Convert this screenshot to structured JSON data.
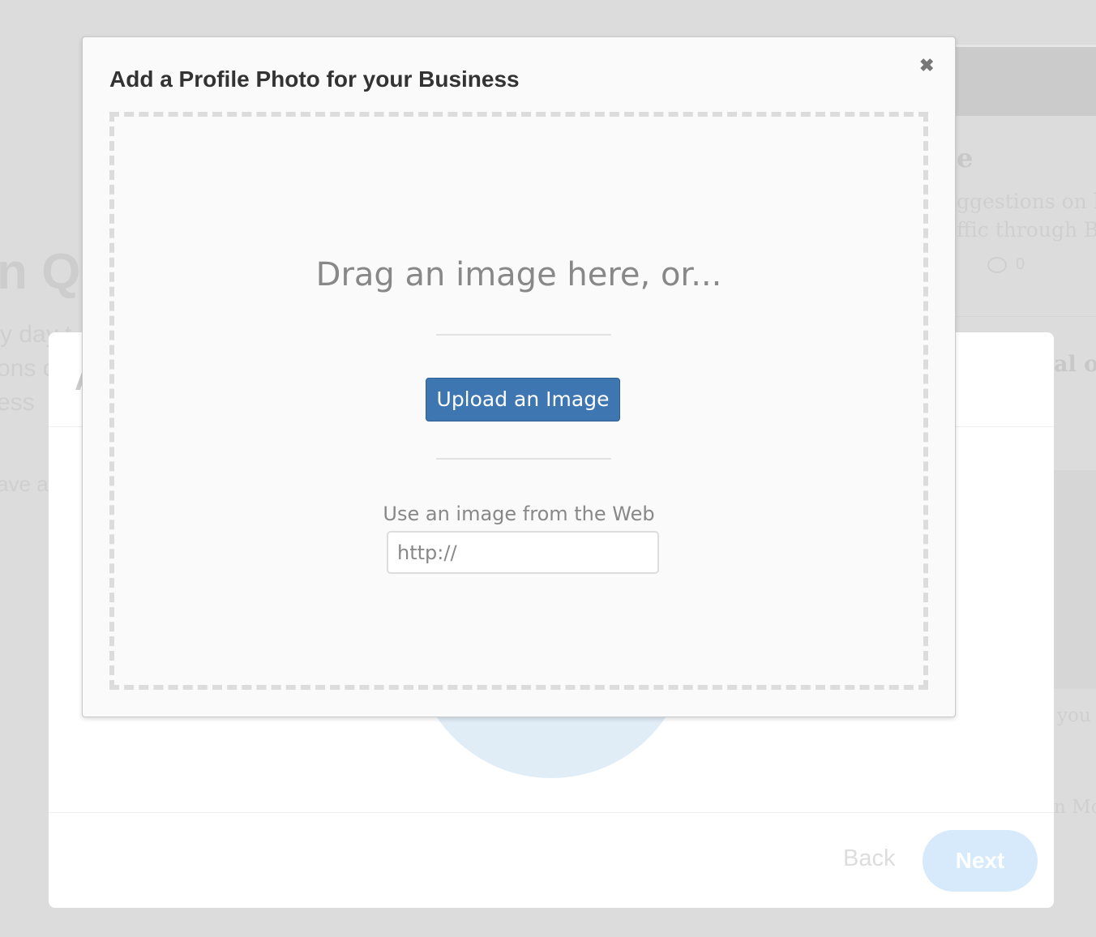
{
  "background": {
    "left_fragments": [
      "n Qu",
      "y day t",
      "ons o",
      "ess",
      "ave a"
    ],
    "right_fragments": {
      "heading": "e",
      "line1": "ggestions on ho",
      "line2": "ffic through Blog",
      "comment_count": "0",
      "bold_line": "al of",
      "line3": "you a",
      "line4": "n Mor"
    },
    "card_letter": "A",
    "footer": {
      "back_label": "Back",
      "next_label": "Next"
    },
    "colors": {
      "next_bg": "#d6eafc",
      "circle": "#e0ecf6"
    }
  },
  "modal": {
    "title": "Add a Profile Photo for your Business",
    "close_icon": "close-icon",
    "drop_text": "Drag an image here, or...",
    "upload_label": "Upload an Image",
    "web_label": "Use an image from the Web",
    "url_value": "http://",
    "colors": {
      "upload_bg": "#3d76b0"
    }
  }
}
